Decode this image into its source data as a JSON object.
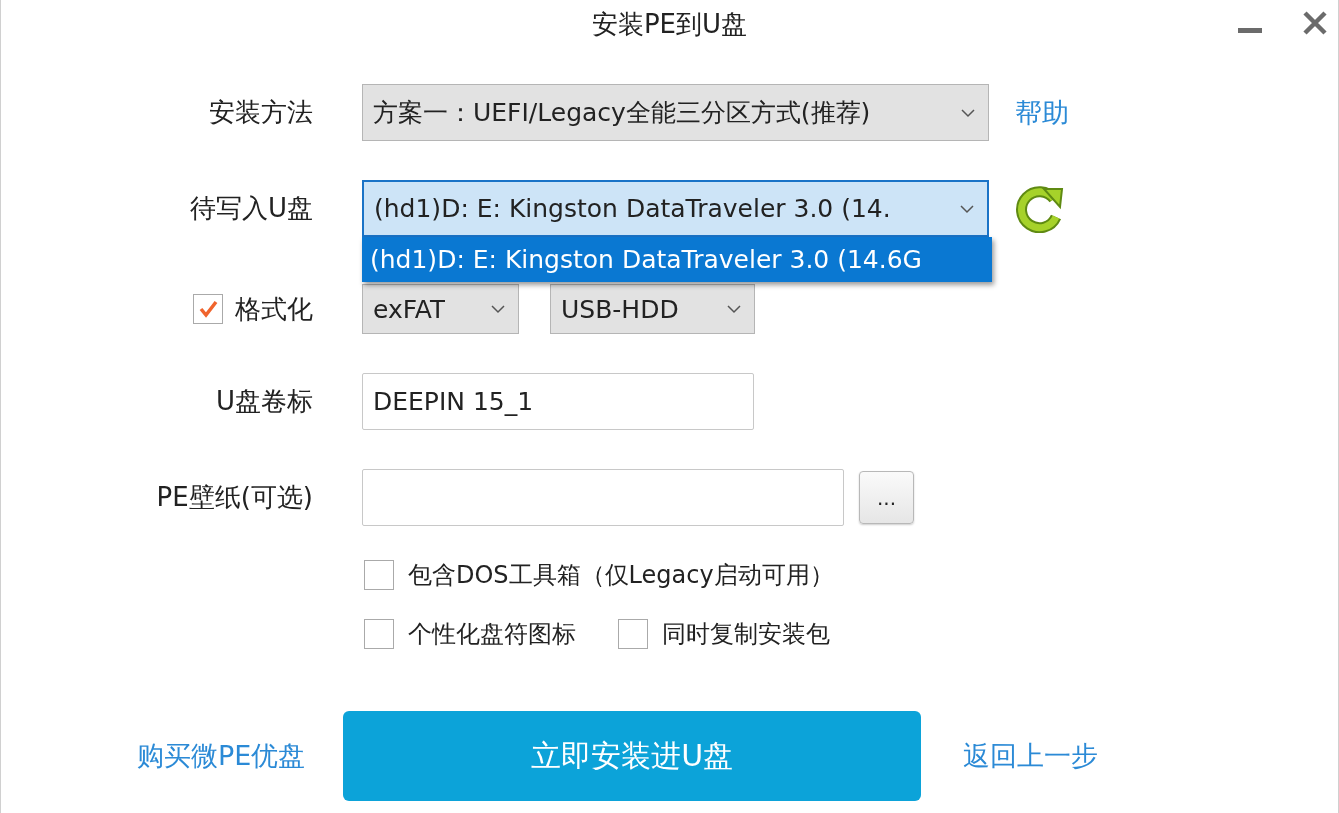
{
  "window": {
    "title": "安装PE到U盘"
  },
  "install_method": {
    "label": "安装方法",
    "value": "方案一：UEFI/Legacy全能三分区方式(推荐)",
    "link": "帮助"
  },
  "target_drive": {
    "label": "待写入U盘",
    "value": "(hd1)D: E: Kingston DataTraveler 3.0 (14.",
    "expanded": true,
    "options": [
      {
        "label": "(hd1)D: E: Kingston DataTraveler 3.0 (14.6G",
        "selected": true
      }
    ]
  },
  "format": {
    "label": "格式化",
    "checked": true,
    "filesystem": "exFAT",
    "boot_mode": "USB-HDD"
  },
  "volume_label": {
    "label": "U盘卷标",
    "value": "DEEPIN 15_1"
  },
  "wallpaper": {
    "label": "PE壁纸(可选)",
    "browse": "..."
  },
  "options": [
    {
      "label": "包含DOS工具箱（仅Legacy启动可用）",
      "checked": false
    },
    {
      "label": "个性化盘符图标",
      "checked": false
    },
    {
      "label": "同时复制安装包",
      "checked": false
    }
  ],
  "footer": {
    "buy_link": "购买微PE优盘",
    "install_button": "立即安装进U盘",
    "back_link": "返回上一步"
  }
}
